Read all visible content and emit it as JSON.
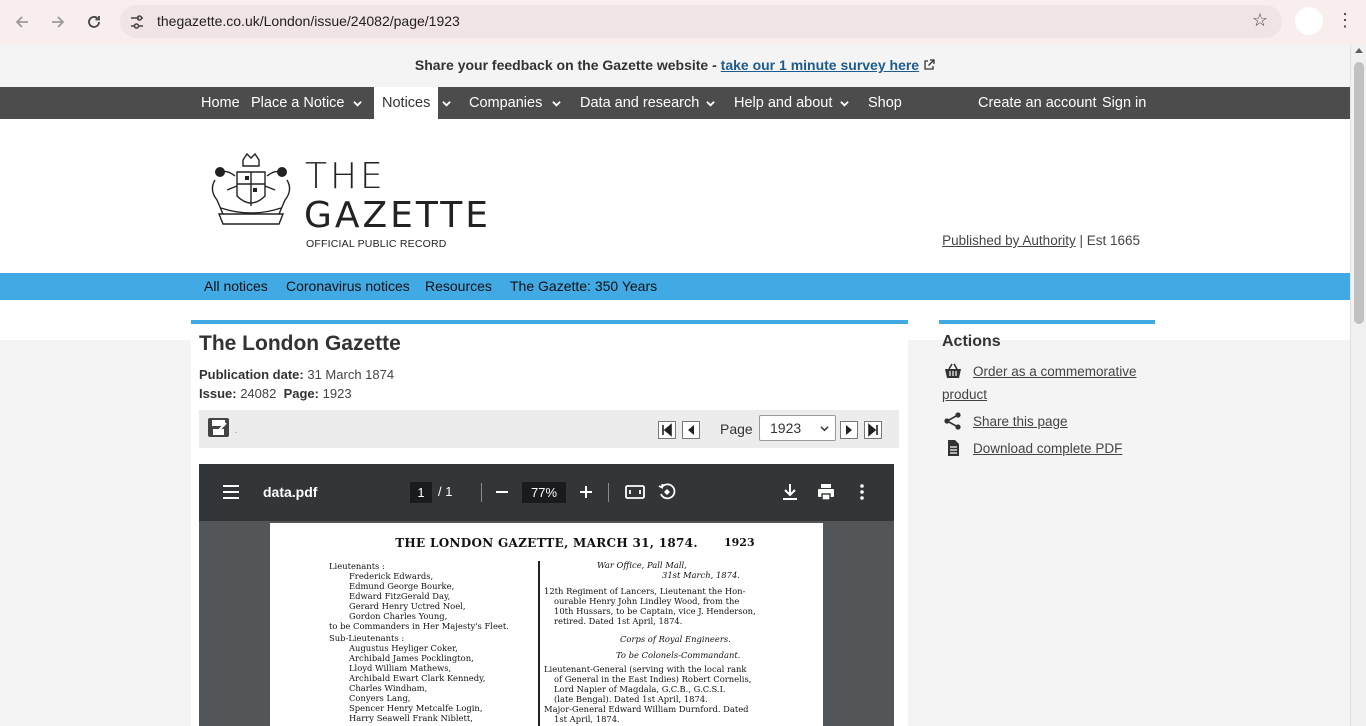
{
  "browser": {
    "url": "thegazette.co.uk/London/issue/24082/page/1923"
  },
  "feedback": {
    "text": "Share your feedback on the Gazette website - ",
    "link": "take our 1 minute survey here"
  },
  "topnav": {
    "items": [
      "Home",
      "Place a Notice",
      "Notices",
      "Companies",
      "Data and research",
      "Help and about",
      "Shop"
    ],
    "current": "Notices",
    "create_account": "Create an account",
    "sign_in": "Sign in"
  },
  "masthead": {
    "logo_line1": "THE",
    "logo_line2": "GAZETTE",
    "logo_sub": "OFFICIAL PUBLIC RECORD",
    "published_by": "Published by Authority",
    "est": " | Est 1665"
  },
  "subnav": {
    "items": [
      "All notices",
      "Coronavirus notices",
      "Resources",
      "The Gazette: 350 Years"
    ]
  },
  "notice": {
    "title": "The London Gazette",
    "publication_date_label": "Publication date:",
    "publication_date": "31 March 1874",
    "issue_label": "Issue:",
    "issue": "24082",
    "page_label": "Page:",
    "page": "1923"
  },
  "pager": {
    "page_label": "Page",
    "selected_page": "1923"
  },
  "pdf_viewer": {
    "filename": "data.pdf",
    "current_page": "1",
    "total_pages": "/ 1",
    "zoom": "77%"
  },
  "pdf_page": {
    "header": "THE LONDON GAZETTE, MARCH 31, 1874.",
    "page_number": "1923",
    "left_column": [
      "Lieutenants :",
      "Frederick Edwards,",
      "Edmund George Bourke,",
      "Edward FitzGerald Day,",
      "Gerard Henry Uctred Noel,",
      "Gordon Charles Young,",
      "to be Commanders in Her Majesty's Fleet.",
      "Sub-Lieutenants :",
      "Augustus Heyliger Coker,",
      "Archibald James Pocklington,",
      "Lloyd William Mathews,",
      "Archibald Ewart Clark Kennedy,",
      "Charles Windham,",
      "Conyers Lang,",
      "Spencer Henry Metcalfe Login,",
      "Harry Seawell Frank Niblett,"
    ],
    "right_column": [
      "War Office, Pall Mall,",
      "31st March, 1874.",
      "12th Regiment of Lancers, Lieutenant the Hon-",
      "ourable Henry John Lindley Wood, from the",
      "10th Hussars, to be Captain, vice J. Henderson,",
      "retired.   Dated 1st April, 1874.",
      "Corps of Royal Engineers.",
      "To be Colonels-Commandant.",
      "Lieutenant-General (serving with the local rank",
      "of General in the East Indies) Robert Cornelis,",
      "Lord Napier of Magdala, G.C.B., G.C.S.I.",
      "(late Bengal).   Dated 1st April, 1874.",
      "Major-General Edward William Durnford.   Dated",
      "1st April, 1874."
    ]
  },
  "actions": {
    "heading": "Actions",
    "order_line1": "Order as a commemorative",
    "order_line2": "product",
    "share": "Share this page",
    "download": "Download complete PDF"
  }
}
